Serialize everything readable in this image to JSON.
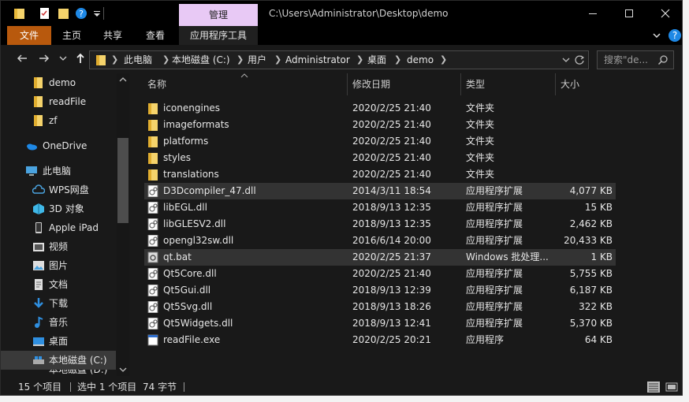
{
  "titlebar": {
    "context_tab": "管理",
    "path_title": "C:\\Users\\Administrator\\Desktop\\demo"
  },
  "ribbon": {
    "tabs": [
      "文件",
      "主页",
      "共享",
      "查看",
      "应用程序工具"
    ]
  },
  "address": {
    "crumbs": [
      "此电脑",
      "本地磁盘 (C:)",
      "用户",
      "Administrator",
      "桌面",
      "demo"
    ],
    "search_placeholder": "搜索\"de..."
  },
  "nav": {
    "items": [
      {
        "label": "demo",
        "icon": "folder-pinned-icon"
      },
      {
        "label": "readFile",
        "icon": "folder-pinned-icon"
      },
      {
        "label": "zf",
        "icon": "folder-pinned-icon"
      },
      {
        "label": "OneDrive",
        "icon": "onedrive-icon"
      },
      {
        "label": "此电脑",
        "icon": "this-pc-icon"
      },
      {
        "label": "WPS网盘",
        "icon": "wps-cloud-icon"
      },
      {
        "label": "3D 对象",
        "icon": "3d-objects-icon"
      },
      {
        "label": "Apple iPad",
        "icon": "ipad-icon"
      },
      {
        "label": "视频",
        "icon": "videos-icon"
      },
      {
        "label": "图片",
        "icon": "pictures-icon"
      },
      {
        "label": "文档",
        "icon": "documents-icon"
      },
      {
        "label": "下载",
        "icon": "downloads-icon"
      },
      {
        "label": "音乐",
        "icon": "music-icon"
      },
      {
        "label": "桌面",
        "icon": "desktop-icon"
      },
      {
        "label": "本地磁盘 (C:)",
        "icon": "drive-icon"
      },
      {
        "label": "本地磁盘 (D:)",
        "icon": "drive-icon"
      }
    ]
  },
  "columns": {
    "name": "名称",
    "date": "修改日期",
    "type": "类型",
    "size": "大小"
  },
  "files": [
    {
      "name": "iconengines",
      "date": "2020/2/25 21:40",
      "type": "文件夹",
      "size": "",
      "icon": "folder-icon"
    },
    {
      "name": "imageformats",
      "date": "2020/2/25 21:40",
      "type": "文件夹",
      "size": "",
      "icon": "folder-icon"
    },
    {
      "name": "platforms",
      "date": "2020/2/25 21:40",
      "type": "文件夹",
      "size": "",
      "icon": "folder-icon"
    },
    {
      "name": "styles",
      "date": "2020/2/25 21:40",
      "type": "文件夹",
      "size": "",
      "icon": "folder-icon"
    },
    {
      "name": "translations",
      "date": "2020/2/25 21:40",
      "type": "文件夹",
      "size": "",
      "icon": "folder-icon"
    },
    {
      "name": "D3Dcompiler_47.dll",
      "date": "2014/3/11 18:54",
      "type": "应用程序扩展",
      "size": "4,077 KB",
      "icon": "dll-icon"
    },
    {
      "name": "libEGL.dll",
      "date": "2018/9/13 12:35",
      "type": "应用程序扩展",
      "size": "15 KB",
      "icon": "dll-icon"
    },
    {
      "name": "libGLESV2.dll",
      "date": "2018/9/13 12:35",
      "type": "应用程序扩展",
      "size": "2,462 KB",
      "icon": "dll-icon"
    },
    {
      "name": "opengl32sw.dll",
      "date": "2016/6/14 20:00",
      "type": "应用程序扩展",
      "size": "20,433 KB",
      "icon": "dll-icon"
    },
    {
      "name": "qt.bat",
      "date": "2020/2/25 21:37",
      "type": "Windows 批处理...",
      "size": "1 KB",
      "icon": "bat-icon"
    },
    {
      "name": "Qt5Core.dll",
      "date": "2020/2/25 21:40",
      "type": "应用程序扩展",
      "size": "5,755 KB",
      "icon": "dll-icon"
    },
    {
      "name": "Qt5Gui.dll",
      "date": "2018/9/13 12:39",
      "type": "应用程序扩展",
      "size": "6,187 KB",
      "icon": "dll-icon"
    },
    {
      "name": "Qt5Svg.dll",
      "date": "2018/9/13 18:26",
      "type": "应用程序扩展",
      "size": "322 KB",
      "icon": "dll-icon"
    },
    {
      "name": "Qt5Widgets.dll",
      "date": "2018/9/13 12:41",
      "type": "应用程序扩展",
      "size": "5,370 KB",
      "icon": "dll-icon"
    },
    {
      "name": "readFile.exe",
      "date": "2020/2/25 20:21",
      "type": "应用程序",
      "size": "64 KB",
      "icon": "exe-icon"
    }
  ],
  "status": {
    "count": "15 个项目",
    "selected": "选中 1 个项目",
    "bytes": "74 字节"
  },
  "colors": {
    "accent": "#b8590d",
    "context_tab": "#e8c9f5",
    "help": "#1e88e5"
  }
}
